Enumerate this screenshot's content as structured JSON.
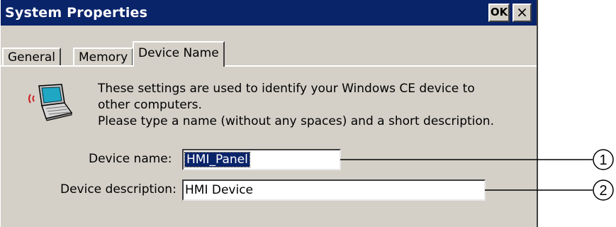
{
  "window": {
    "title": "System Properties",
    "ok_label": "OK",
    "close_label": "×"
  },
  "tabs": [
    {
      "label": "General"
    },
    {
      "label": "Memory"
    },
    {
      "label": "Device Name",
      "active": true
    }
  ],
  "description": {
    "line1": "These settings are used to identify your Windows CE device to",
    "line2": "other computers.",
    "line3": "Please type a name (without any spaces) and a short description."
  },
  "device_name": {
    "label": "Device name:",
    "value": "HMI_Panel"
  },
  "device_description": {
    "label": "Device description:",
    "value": "HMI Device"
  },
  "callouts": [
    "1",
    "2"
  ],
  "icon": "network-computer-icon",
  "colors": {
    "titlebar": "#0a246a",
    "window_bg": "#d4d0c8",
    "selection": "#0a246a"
  }
}
